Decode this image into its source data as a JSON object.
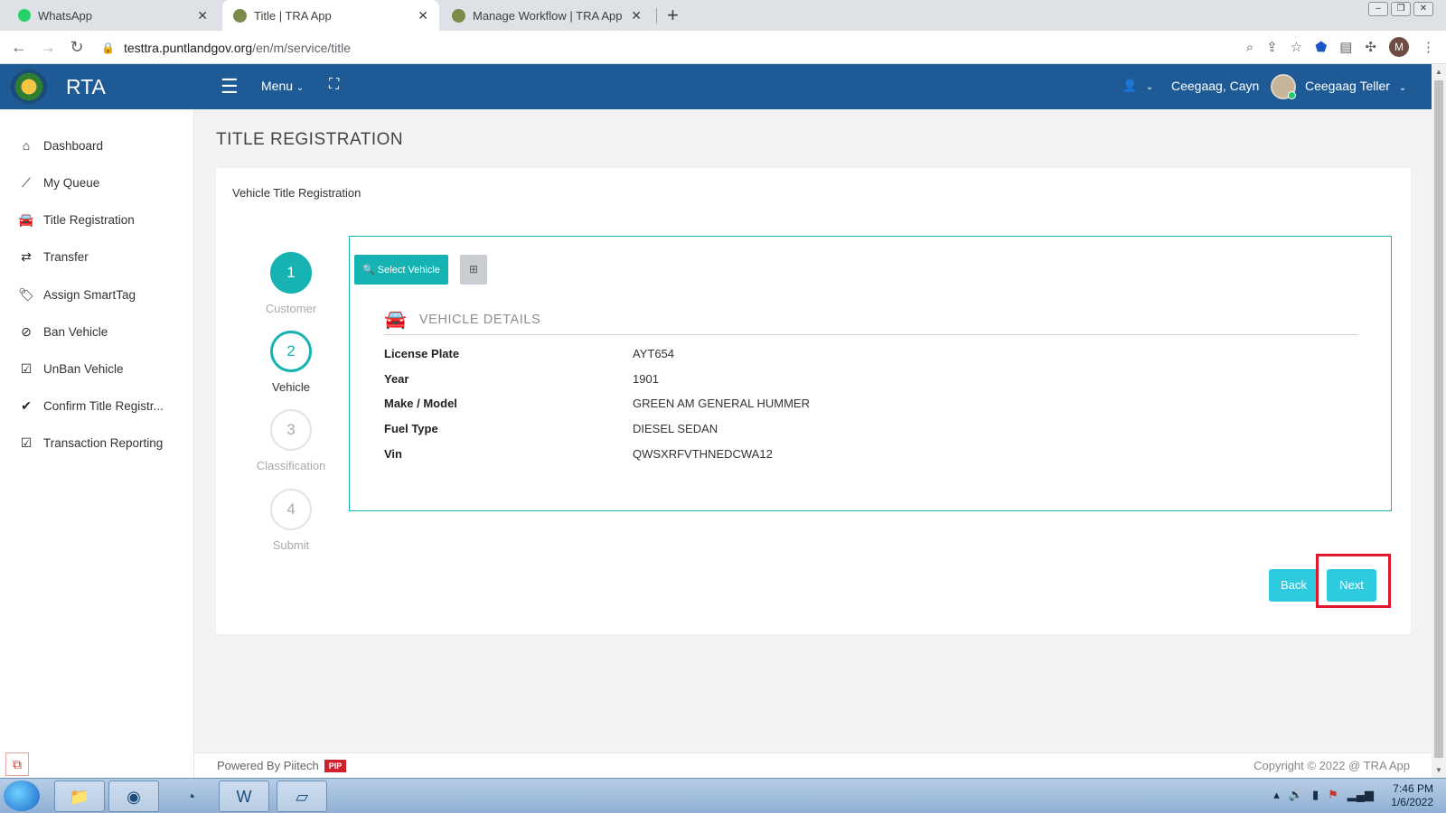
{
  "browser": {
    "tabs": [
      {
        "title": "WhatsApp",
        "icon": "whatsapp-icon"
      },
      {
        "title": "Title | TRA App",
        "icon": "rta-logo-icon",
        "active": true
      },
      {
        "title": "Manage Workflow | TRA App",
        "icon": "rta-logo-icon"
      }
    ],
    "url_host": "testtra.puntlandgov.org",
    "url_path": "/en/m/service/title",
    "profile_initial": "M"
  },
  "header": {
    "brand": "RTA",
    "menu_label": "Menu",
    "user_name": "Ceegaag, Cayn",
    "role": "Ceegaag Teller"
  },
  "sidebar": {
    "items": [
      {
        "label": "Dashboard",
        "icon": "home-icon"
      },
      {
        "label": "My Queue",
        "icon": "trend-icon"
      },
      {
        "label": "Title Registration",
        "icon": "car-icon"
      },
      {
        "label": "Transfer",
        "icon": "exchange-icon"
      },
      {
        "label": "Assign SmartTag",
        "icon": "tags-icon"
      },
      {
        "label": "Ban Vehicle",
        "icon": "ban-icon"
      },
      {
        "label": "UnBan Vehicle",
        "icon": "check-square-icon"
      },
      {
        "label": "Confirm Title Registr...",
        "icon": "check-icon"
      },
      {
        "label": "Transaction Reporting",
        "icon": "check-square-icon"
      }
    ]
  },
  "page": {
    "title": "TITLE REGISTRATION",
    "card_title": "Vehicle Title Registration",
    "steps": [
      {
        "number": "1",
        "label": "Customer",
        "state": "done"
      },
      {
        "number": "2",
        "label": "Vehicle",
        "state": "current"
      },
      {
        "number": "3",
        "label": "Classification",
        "state": "pending"
      },
      {
        "number": "4",
        "label": "Submit",
        "state": "pending"
      }
    ],
    "select_vehicle_label": "Select Vehicle",
    "section_heading": "VEHICLE DETAILS",
    "details": [
      {
        "key": "License Plate",
        "value": "AYT654"
      },
      {
        "key": "Year",
        "value": "1901"
      },
      {
        "key": "Make / Model",
        "value": "GREEN AM GENERAL HUMMER"
      },
      {
        "key": "Fuel Type",
        "value": "DIESEL SEDAN"
      },
      {
        "key": "Vin",
        "value": "QWSXRFVTHNEDCWA12"
      }
    ],
    "back_label": "Back",
    "next_label": "Next"
  },
  "footer": {
    "powered_by": "Powered By Piitech",
    "badge": "PIP",
    "copyright": "Copyright © 2022 @ TRA App"
  },
  "taskbar": {
    "time": "7:46 PM",
    "date": "1/6/2022"
  },
  "colors": {
    "header_bg": "#1d5a96",
    "accent": "#17b3b3",
    "button": "#2ecbe0",
    "highlight": "#e0162b"
  }
}
